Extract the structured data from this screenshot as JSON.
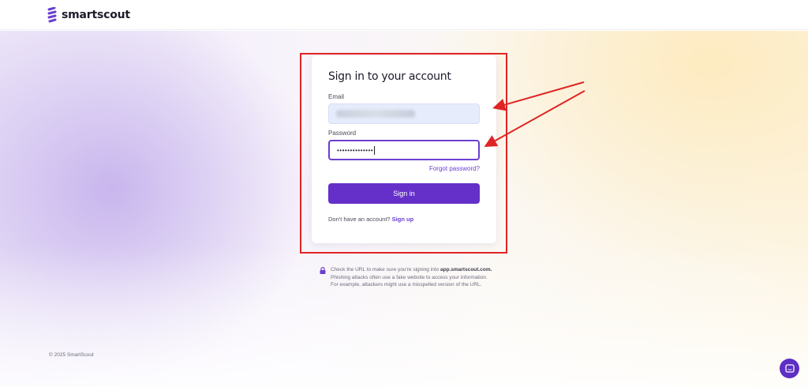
{
  "header": {
    "brand": "smartscout",
    "brand_color": "#6b3fd1"
  },
  "card": {
    "title": "Sign in to your account",
    "email_label": "Email",
    "password_label": "Password",
    "password_value": "••••••••••••••",
    "forgot_label": "Forgot password?",
    "signin_label": "Sign in",
    "no_account_text": "Don't have an account?",
    "signup_label": "Sign up"
  },
  "notice": {
    "lead": "Check the URL to make sure you're signing into",
    "domain": "app.smartscout.com.",
    "rest": "Phishing attacks often use a fake website to access your information. For example, attackers might use a misspelled version of the URL."
  },
  "footer": {
    "copyright": "© 2025 SmartScout"
  },
  "colors": {
    "primary": "#6430c9",
    "annotation_red": "#e02424"
  },
  "icons": {
    "logo": "smartscout-logo-icon",
    "lock": "lock-icon",
    "chat": "chat-icon"
  }
}
